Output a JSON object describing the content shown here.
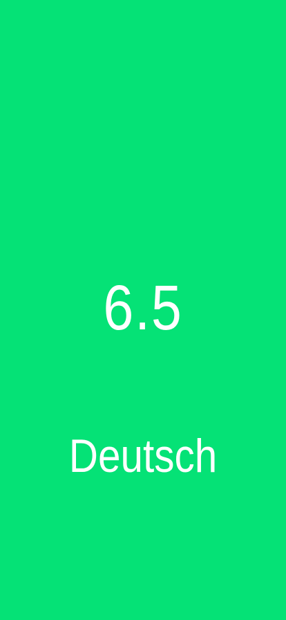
{
  "screen": {
    "background_color": "#05e276",
    "text_color": "#ffffff",
    "grade": "6.5",
    "subject": "Deutsch"
  }
}
